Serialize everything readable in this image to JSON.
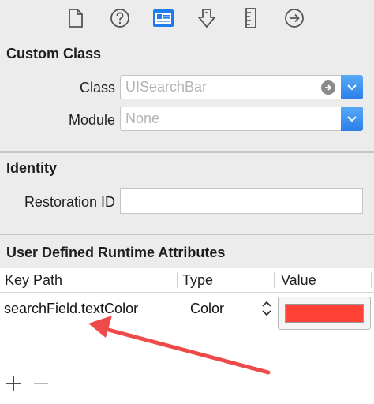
{
  "toolbar": {
    "icons": [
      "file-inspector-icon",
      "quick-help-icon",
      "identity-inspector-icon",
      "attributes-inspector-icon",
      "size-inspector-icon",
      "connections-inspector-icon"
    ]
  },
  "custom_class": {
    "title": "Custom Class",
    "class_label": "Class",
    "class_placeholder": "UISearchBar",
    "module_label": "Module",
    "module_placeholder": "None"
  },
  "identity": {
    "title": "Identity",
    "restoration_label": "Restoration ID",
    "restoration_value": ""
  },
  "runtime_attributes": {
    "title": "User Defined Runtime Attributes",
    "columns": [
      "Key Path",
      "Type",
      "Value"
    ],
    "rows": [
      {
        "key_path": "searchField.textColor",
        "type": "Color",
        "value_color": "#ff4136"
      }
    ]
  },
  "colors": {
    "accent": "#2a7fe9",
    "annotation_arrow": "#ef4a4a"
  }
}
